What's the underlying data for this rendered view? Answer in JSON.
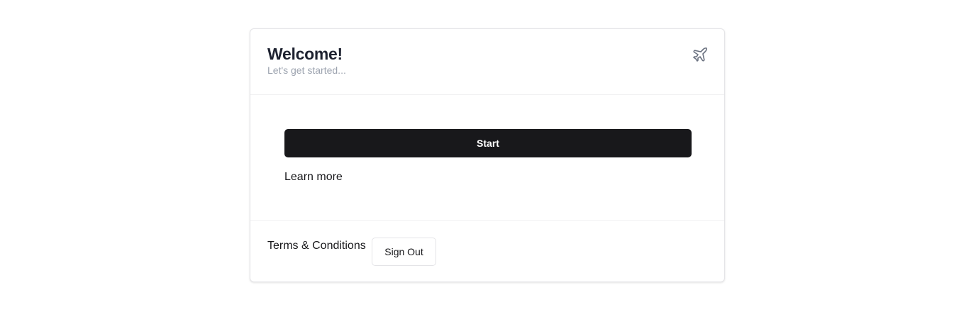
{
  "header": {
    "title": "Welcome!",
    "subtitle": "Let's get started...",
    "icon": "plane-icon"
  },
  "body": {
    "start_label": "Start",
    "learn_more_label": "Learn more"
  },
  "footer": {
    "terms_label": "Terms & Conditions",
    "sign_out_label": "Sign Out"
  },
  "colors": {
    "primary_button_bg": "#18181b",
    "primary_button_text": "#ffffff",
    "title_text": "#1e2230",
    "subtitle_text": "#9ca3af",
    "icon_stroke": "#6b7280",
    "border": "#e4e4e7"
  }
}
